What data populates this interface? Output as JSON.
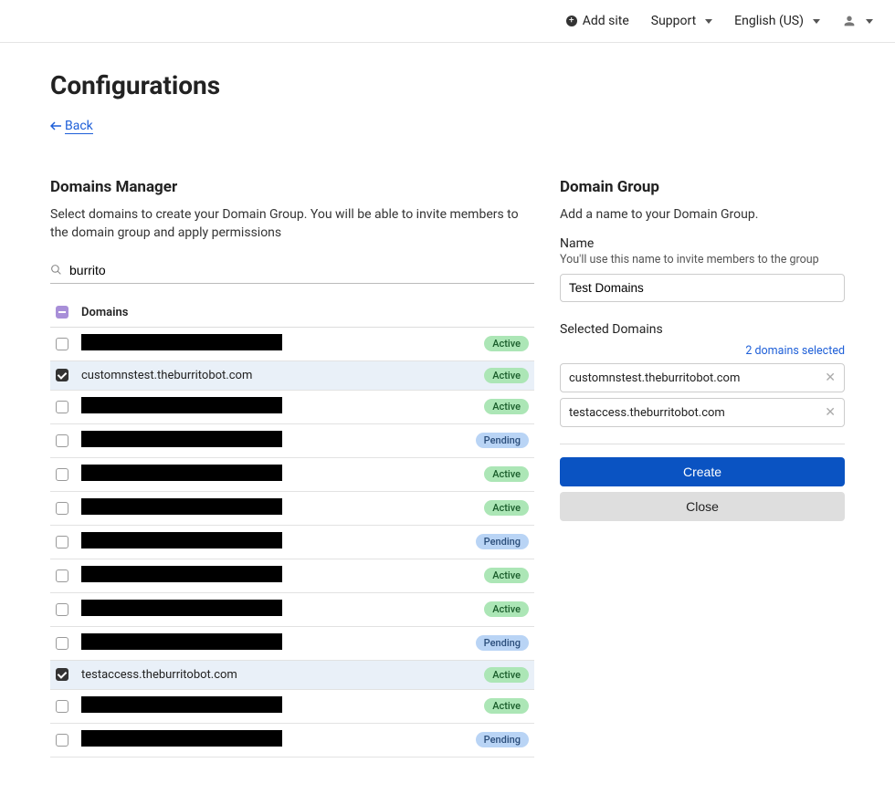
{
  "topbar": {
    "add_site": "Add site",
    "support": "Support",
    "language": "English (US)"
  },
  "page_title": "Configurations",
  "back_label": "Back",
  "left": {
    "title": "Domains Manager",
    "subtitle": "Select domains to create your Domain Group. You will be able to invite members to the domain group and apply permissions",
    "search_value": "burrito",
    "column_header": "Domains",
    "rows": [
      {
        "checked": false,
        "name": "",
        "redacted": true,
        "status": "Active"
      },
      {
        "checked": true,
        "name": "customnstest.theburritobot.com",
        "redacted": false,
        "status": "Active"
      },
      {
        "checked": false,
        "name": "",
        "redacted": true,
        "status": "Active"
      },
      {
        "checked": false,
        "name": "",
        "redacted": true,
        "status": "Pending"
      },
      {
        "checked": false,
        "name": "",
        "redacted": true,
        "status": "Active"
      },
      {
        "checked": false,
        "name": "",
        "redacted": true,
        "status": "Active"
      },
      {
        "checked": false,
        "name": "",
        "redacted": true,
        "status": "Pending"
      },
      {
        "checked": false,
        "name": "",
        "redacted": true,
        "status": "Active"
      },
      {
        "checked": false,
        "name": "",
        "redacted": true,
        "status": "Active"
      },
      {
        "checked": false,
        "name": "",
        "redacted": true,
        "status": "Pending"
      },
      {
        "checked": true,
        "name": "testaccess.theburritobot.com",
        "redacted": false,
        "status": "Active"
      },
      {
        "checked": false,
        "name": "",
        "redacted": true,
        "status": "Active"
      },
      {
        "checked": false,
        "name": "",
        "redacted": true,
        "status": "Pending"
      }
    ]
  },
  "right": {
    "title": "Domain Group",
    "subtitle": "Add a name to your Domain Group.",
    "name_label": "Name",
    "name_help": "You'll use this name to invite members to the group",
    "name_value": "Test Domains",
    "selected_label": "Selected Domains",
    "selected_count": "2 domains selected",
    "selected": [
      "customnstest.theburritobot.com",
      "testaccess.theburritobot.com"
    ],
    "create_label": "Create",
    "close_label": "Close"
  }
}
